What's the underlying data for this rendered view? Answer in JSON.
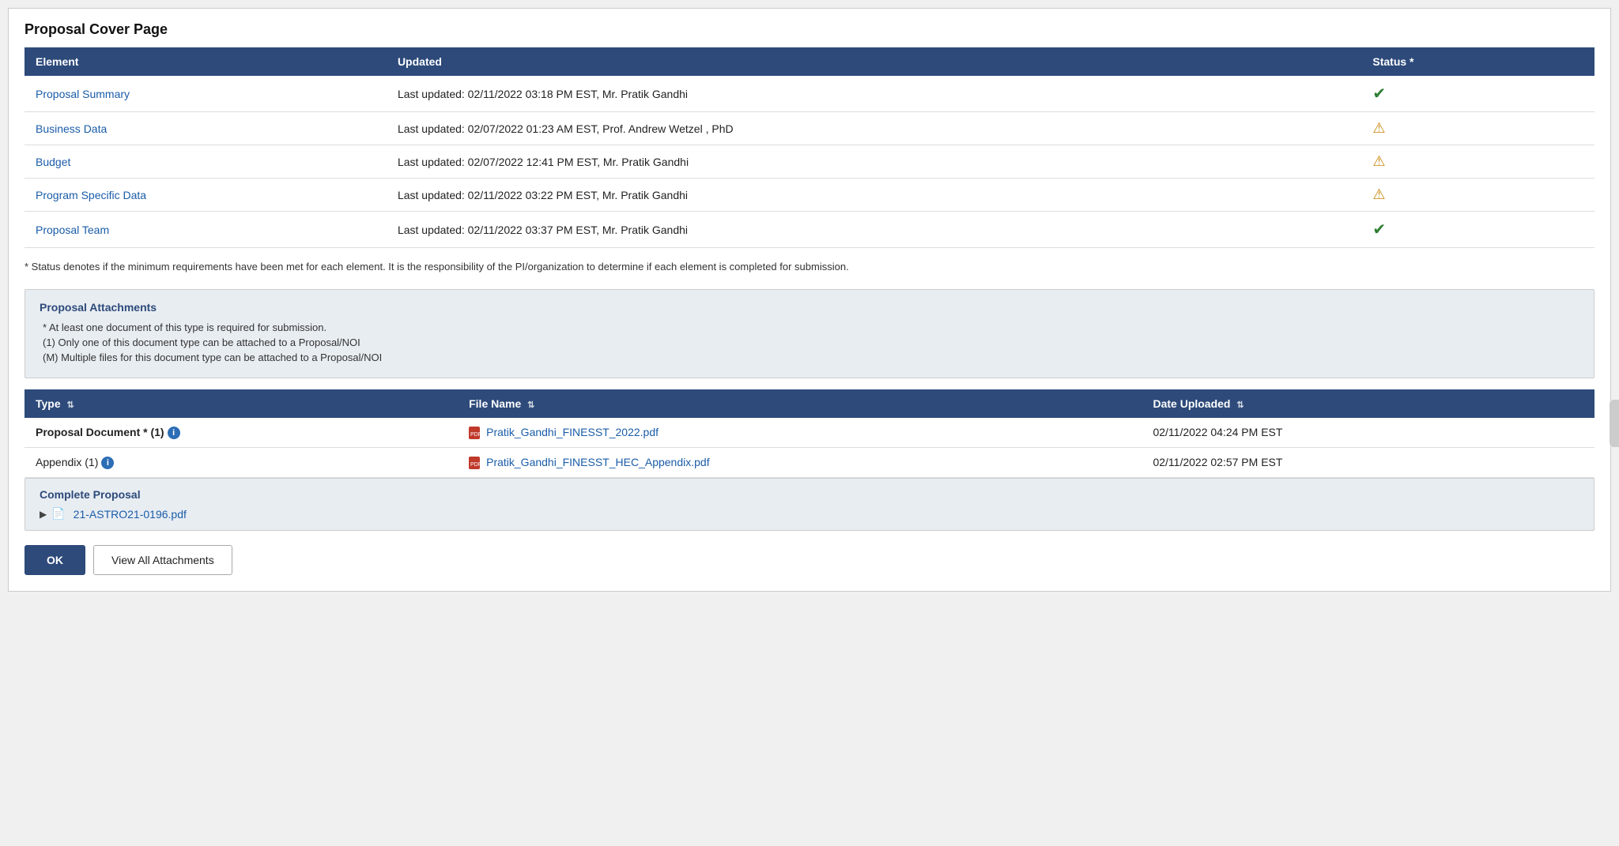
{
  "page": {
    "title": "Proposal Cover Page"
  },
  "cover_table": {
    "headers": [
      "Element",
      "Updated",
      "Status *"
    ],
    "rows": [
      {
        "element": "Proposal Summary",
        "updated": "Last updated: 02/11/2022 03:18 PM EST,  Mr. Pratik Gandhi",
        "status": "check"
      },
      {
        "element": "Business Data",
        "updated": "Last updated: 02/07/2022 01:23 AM EST,  Prof. Andrew Wetzel , PhD",
        "status": "warn"
      },
      {
        "element": "Budget",
        "updated": "Last updated: 02/07/2022 12:41 PM EST,  Mr. Pratik Gandhi",
        "status": "warn"
      },
      {
        "element": "Program Specific Data",
        "updated": "Last updated: 02/11/2022 03:22 PM EST,  Mr. Pratik Gandhi",
        "status": "warn"
      },
      {
        "element": "Proposal Team",
        "updated": "Last updated: 02/11/2022 03:37 PM EST,  Mr. Pratik Gandhi",
        "status": "check"
      }
    ],
    "footnote": "* Status denotes if the minimum requirements have been met for each element. It is the responsibility of the PI/organization to determine if each element is completed for submission."
  },
  "attachments": {
    "section_title": "Proposal Attachments",
    "notes": [
      "*  At least one document of this type is required for submission.",
      "(1) Only one of this document type can be attached to a Proposal/NOI",
      "(M) Multiple files for this document type can be attached to a Proposal/NOI"
    ],
    "headers": [
      "Type",
      "File Name",
      "Date Uploaded"
    ],
    "rows": [
      {
        "type_label": "Proposal Document  * (1)",
        "type_bold": true,
        "has_info": true,
        "filename": "Pratik_Gandhi_FINESST_2022.pdf",
        "date": "02/11/2022 04:24 PM EST"
      },
      {
        "type_label": "Appendix  (1)",
        "type_bold": false,
        "has_info": true,
        "filename": "Pratik_Gandhi_FINESST_HEC_Appendix.pdf",
        "date": "02/11/2022 02:57 PM EST"
      }
    ]
  },
  "complete_proposal": {
    "section_title": "Complete Proposal",
    "filename": "21-ASTRO21-0196.pdf"
  },
  "buttons": {
    "ok": "OK",
    "view_all": "View All Attachments"
  },
  "icons": {
    "check": "✔",
    "warn": "⚠",
    "pdf": "📄",
    "info": "i",
    "sort": "⇅",
    "chevron_right": "▶"
  }
}
